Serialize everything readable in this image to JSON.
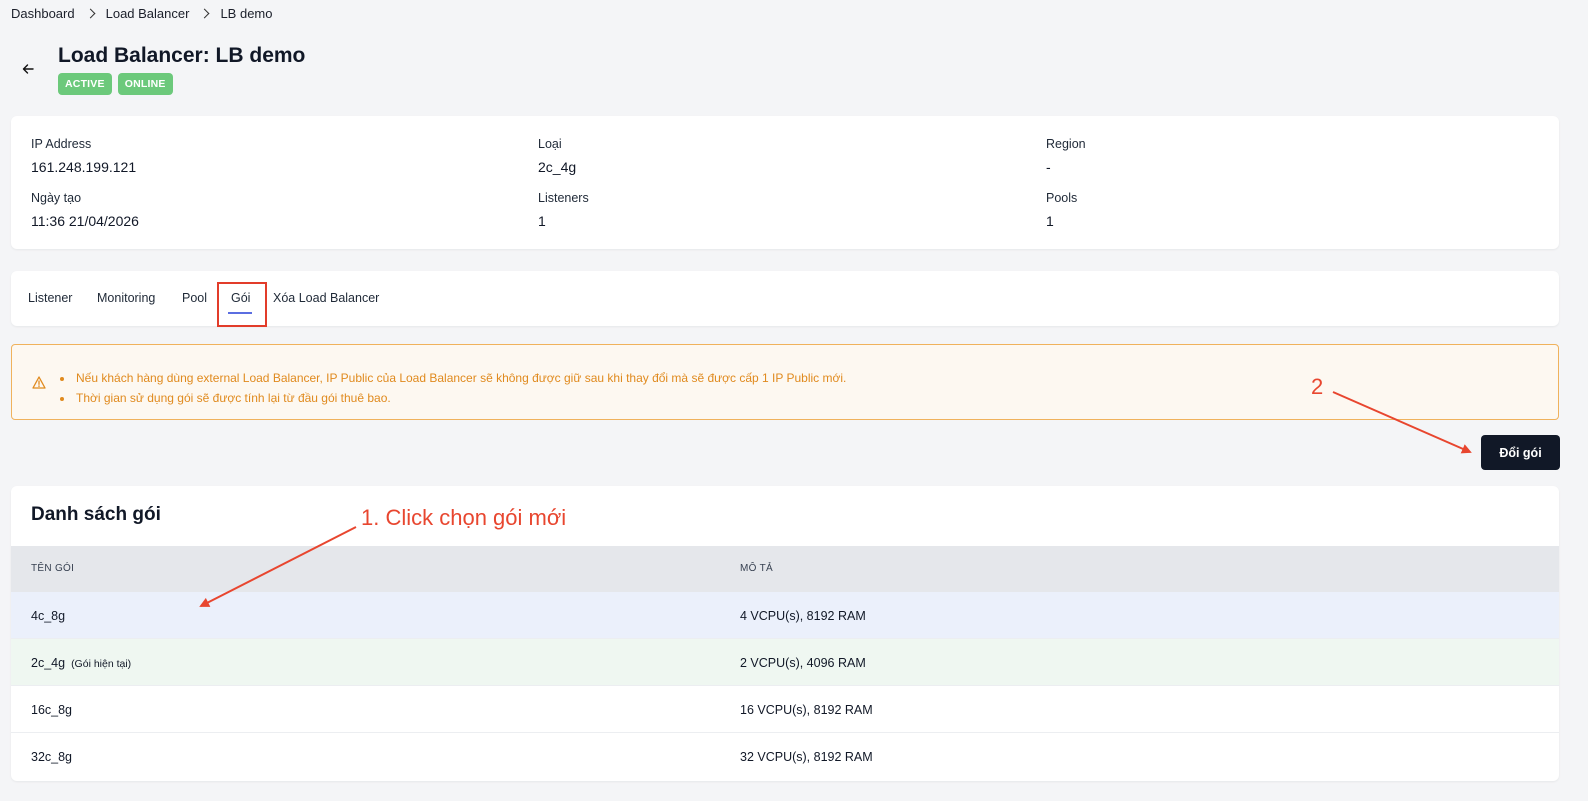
{
  "breadcrumb": [
    "Dashboard",
    "Load Balancer",
    "LB demo"
  ],
  "header": {
    "title": "Load Balancer: LB demo",
    "badges": [
      "ACTIVE",
      "ONLINE"
    ]
  },
  "info": {
    "ip_label": "IP Address",
    "ip_value": "161.248.199.121",
    "type_label": "Loại",
    "type_value": "2c_4g",
    "region_label": "Region",
    "region_value": "-",
    "created_label": "Ngày tạo",
    "created_value": "11:36 21/04/2026",
    "listeners_label": "Listeners",
    "listeners_value": "1",
    "pools_label": "Pools",
    "pools_value": "1"
  },
  "tabs": [
    "Listener",
    "Monitoring",
    "Pool",
    "Gói",
    "Xóa Load Balancer"
  ],
  "active_tab": "Gói",
  "warning": {
    "items": [
      "Nếu khách hàng dùng external Load Balancer, IP Public của Load Balancer sẽ không được giữ sau khi thay đổi mà sẽ được cấp 1 IP Public mới.",
      "Thời gian sử dụng gói sẽ được tính lại từ đầu gói thuê bao."
    ]
  },
  "change_button": "Đổi gói",
  "annotations": {
    "step1": "1. Click  chọn gói mới",
    "step2": "2"
  },
  "plans": {
    "title": "Danh sách gói",
    "columns": [
      "TÊN GÓI",
      "MÔ TẢ"
    ],
    "rows": [
      {
        "name": "4c_8g",
        "note": "",
        "desc": "4 VCPU(s), 8192 RAM"
      },
      {
        "name": "2c_4g",
        "note": "(Gói hiện tại)",
        "desc": "2 VCPU(s), 4096 RAM"
      },
      {
        "name": "16c_8g",
        "note": "",
        "desc": "16 VCPU(s), 8192 RAM"
      },
      {
        "name": "32c_8g",
        "note": "",
        "desc": "32 VCPU(s), 8192 RAM"
      }
    ]
  },
  "colors": {
    "badge_green": "#6cc97b",
    "warning_orange": "#e08a1e",
    "annotation_red": "#e8462f",
    "primary_dark": "#111827"
  }
}
